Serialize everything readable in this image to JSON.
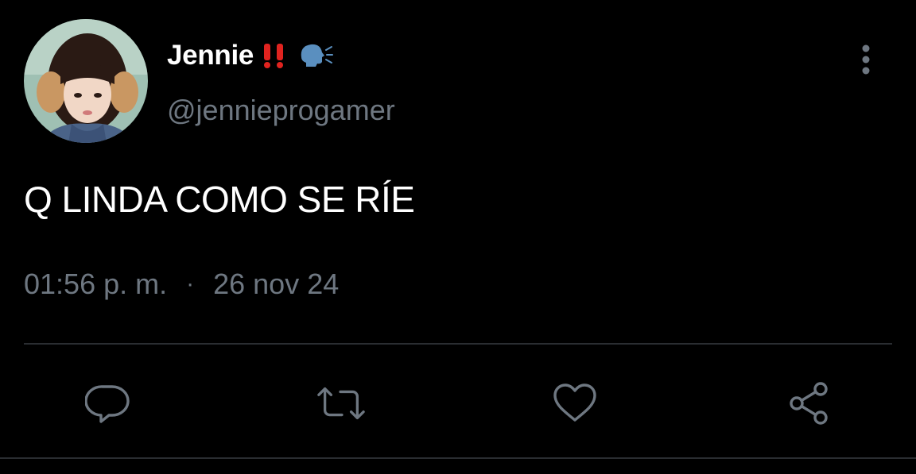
{
  "author": {
    "display_name": "Jennie",
    "handle": "@jennieprogamer",
    "avatar_icon": "avatar-photo"
  },
  "name_emojis": [
    "double-exclamation-icon",
    "speaking-head-icon"
  ],
  "tweet": {
    "text": "Q LINDA COMO SE RÍE",
    "time": "01:56 p. m.",
    "separator": "·",
    "date": "26 nov 24"
  },
  "actions": [
    "reply-icon",
    "retweet-icon",
    "like-icon",
    "share-icon"
  ],
  "colors": {
    "background": "#000000",
    "text": "#ffffff",
    "secondary": "#6e7781",
    "divider": "#2a2d31",
    "emoji_red": "#e0231f",
    "emoji_blue": "#5a8fbf"
  }
}
